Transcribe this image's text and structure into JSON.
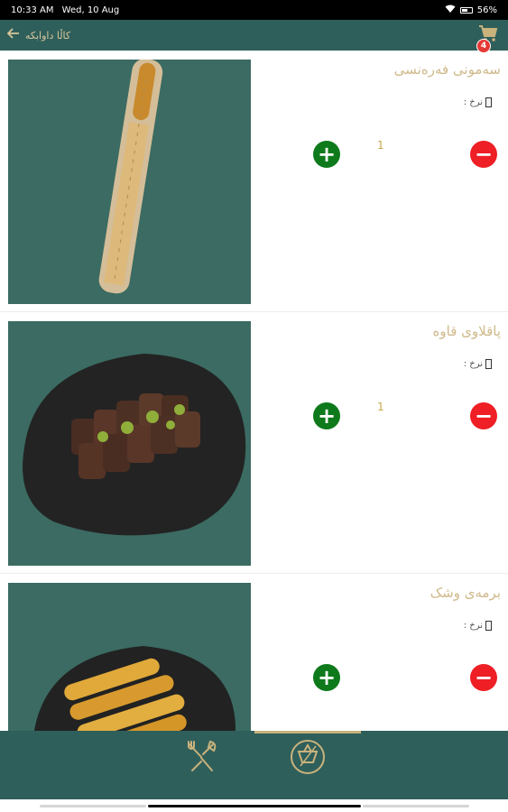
{
  "status_bar": {
    "time": "10:33 AM",
    "date": "Wed, 10 Aug",
    "battery": "56%"
  },
  "app_bar": {
    "title": "کاڵا داوابکە",
    "cart_count": "4"
  },
  "products": [
    {
      "name": "سەمونی فەرەنسی",
      "type_label": "نرخ :",
      "quantity": "1",
      "image": "baguette"
    },
    {
      "name": "پاقلاوی قاوە",
      "type_label": "نرخ :",
      "quantity": "1",
      "image": "baklava"
    },
    {
      "name": "برمەی وشک",
      "type_label": "نرخ :",
      "quantity": "",
      "image": "fried-rolls"
    }
  ],
  "bottom_nav": {
    "tabs": [
      "utensils",
      "cart"
    ],
    "active_tab": "cart"
  },
  "colors": {
    "primary": "#2f5f5b",
    "accent_gold": "#cfb98a",
    "add_green": "#0e7a1b",
    "remove_red": "#ee1f25",
    "badge_red": "#e53935"
  }
}
